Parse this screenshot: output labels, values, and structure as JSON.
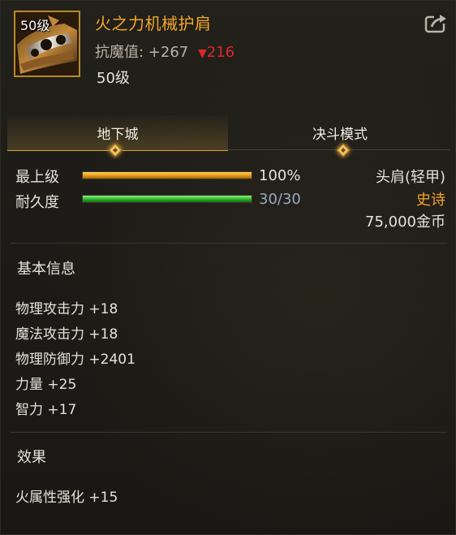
{
  "item": {
    "icon_level": "50级",
    "name": "火之力机械护肩",
    "resist_label": "抗魔值: +267",
    "resist_diff": "216",
    "required_level": "50级"
  },
  "tabs": [
    {
      "label": "地下城",
      "active": true
    },
    {
      "label": "决斗模式",
      "active": false
    }
  ],
  "stats": {
    "grade_label": "最上级",
    "grade_value": "100%",
    "grade_fraction": 1.0,
    "durability_label": "耐久度",
    "durability_value": "30/30",
    "durability_fraction": 1.0
  },
  "info": {
    "slot": "头肩(轻甲)",
    "rarity": "史诗",
    "price": "75,000金币"
  },
  "basic": {
    "title": "基本信息",
    "lines": [
      "物理攻击力 +18",
      "魔法攻击力 +18",
      "物理防御力 +2401",
      "力量 +25",
      "智力 +17"
    ]
  },
  "effect": {
    "title": "效果",
    "lines": [
      "火属性强化 +15"
    ]
  },
  "colors": {
    "rarity_epic": "#f4a62a",
    "resist_down": "#e0262b",
    "accent_gold": "#d9a128"
  },
  "icons": {
    "item_icon": "mechanical-shoulder-armor-icon",
    "share": "share-icon",
    "down_arrow": "down-triangle-icon"
  }
}
